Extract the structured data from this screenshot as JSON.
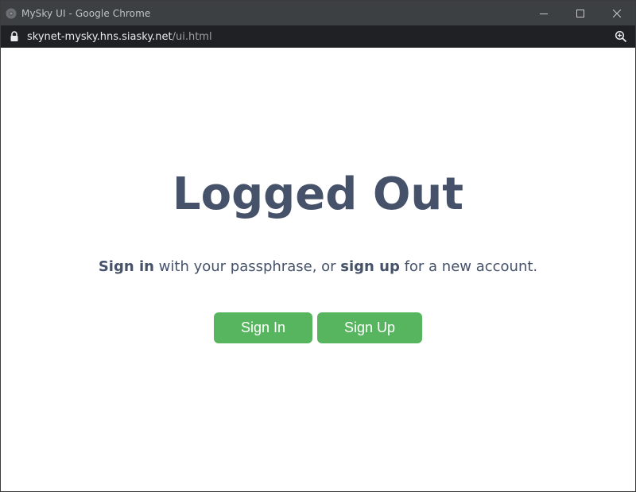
{
  "window": {
    "title": "MySky UI - Google Chrome",
    "controls": [
      "minimize",
      "maximize",
      "close"
    ]
  },
  "address_bar": {
    "host": "skynet-mysky.hns.siasky.net",
    "path": "/ui.html"
  },
  "page": {
    "heading": "Logged Out",
    "subtext": {
      "sign_in": "Sign in",
      "middle": " with your passphrase, or ",
      "sign_up": "sign up",
      "end": " for a new account."
    },
    "buttons": {
      "sign_in": "Sign In",
      "sign_up": "Sign Up"
    }
  },
  "colors": {
    "accent_green": "#57b560",
    "text": "#45526a",
    "titlebar": "#3c4043",
    "addressbar": "#202124"
  },
  "icons": {
    "app": "chrome-app-icon",
    "lock": "lock-icon",
    "zoom": "zoom-in-icon",
    "minimize": "minimize-icon",
    "maximize": "maximize-icon",
    "close": "close-icon"
  }
}
